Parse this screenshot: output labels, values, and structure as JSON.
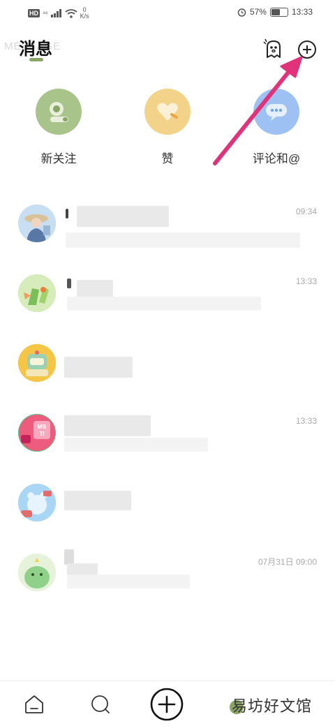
{
  "status_bar": {
    "hd": "HD",
    "signal": "⁴⁶",
    "speed_value": "0",
    "speed_unit": "K/s",
    "battery": "57%",
    "battery_level": 0.57,
    "time": "13:33"
  },
  "header": {
    "title": "消息",
    "ghost_title": "MESSAGE",
    "ghost_button_icon": "ghost-icon",
    "add_button_icon": "plus-circle-icon"
  },
  "categories": [
    {
      "label": "新关注",
      "icon": "camera-icon",
      "color": "#a9c48a"
    },
    {
      "label": "赞",
      "icon": "heart-icon",
      "color": "#f3d38a"
    },
    {
      "label": "评论和@",
      "icon": "chat-bubble-icon",
      "color": "#9cc1f2"
    }
  ],
  "messages": [
    {
      "time": "09:34",
      "avatar": "avatar-woman-hat"
    },
    {
      "time": "13:33",
      "avatar": "avatar-green-plant"
    },
    {
      "time": "",
      "avatar": "avatar-yellow-robot"
    },
    {
      "time": "13:33",
      "avatar": "avatar-mbti"
    },
    {
      "time": "",
      "avatar": "avatar-blue-bear"
    },
    {
      "time": "07月31日 09:00",
      "avatar": "avatar-green-dino"
    }
  ],
  "nav": {
    "home_icon": "home-icon",
    "search_icon": "search-icon",
    "publish_icon": "plus-circle-icon",
    "watermark": "易坊好文馆"
  },
  "colors": {
    "accent_green": "#8aa564",
    "arrow_pink": "#e0337a"
  }
}
